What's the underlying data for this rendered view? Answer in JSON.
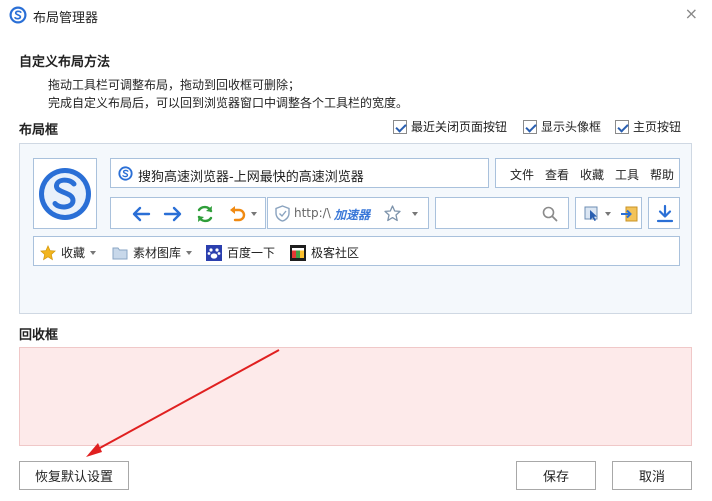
{
  "window": {
    "title": "布局管理器",
    "close_glyph": "×"
  },
  "custom": {
    "heading": "自定义布局方法",
    "lines": [
      "拖动工具栏可调整布局，拖动到回收框可删除；",
      "完成自定义布局后，可以回到浏览器窗口中调整各个工具栏的宽度。"
    ]
  },
  "layout": {
    "heading": "布局框",
    "options": [
      {
        "label": "最近关闭页面按钮",
        "checked": true
      },
      {
        "label": "显示头像框",
        "checked": true
      },
      {
        "label": "主页按钮",
        "checked": true
      }
    ]
  },
  "preview": {
    "tab_title": "搜狗高速浏览器-上网最快的高速浏览器",
    "menu": [
      "文件",
      "查看",
      "收藏",
      "工具",
      "帮助"
    ],
    "address_prefix": "http:/\\",
    "address_accel": "加速器",
    "favorites": [
      {
        "label": "收藏",
        "icon": "star-icon",
        "has_menu": true
      },
      {
        "label": "素材图库",
        "icon": "folder-icon",
        "has_menu": true
      },
      {
        "label": "百度一下",
        "icon": "baidu-paw-icon",
        "has_menu": false
      },
      {
        "label": "极客社区",
        "icon": "geek-community-icon",
        "has_menu": false
      }
    ]
  },
  "recycle": {
    "heading": "回收框"
  },
  "buttons": {
    "restore": "恢复默认设置",
    "save": "保存",
    "cancel": "取消"
  },
  "colors": {
    "accent": "#2a5fb0",
    "toolbar_border": "#a9c1dc",
    "recycle_bg": "#fdeaea",
    "annotation_arrow": "#e02020"
  }
}
